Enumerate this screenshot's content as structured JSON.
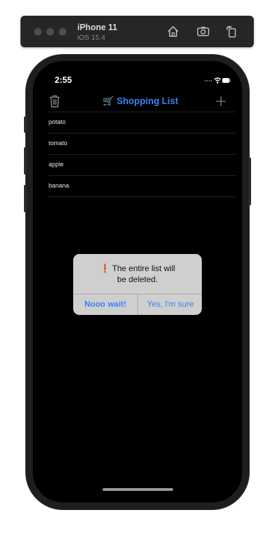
{
  "simulator": {
    "device_name": "iPhone 11",
    "os_version": "iOS 15.4",
    "icons": [
      "home-icon",
      "screenshot-icon",
      "rotate-icon"
    ]
  },
  "status_bar": {
    "time": "2:55",
    "icons": [
      "cellular-signal-icon",
      "wifi-icon",
      "battery-icon"
    ]
  },
  "nav": {
    "title_emoji": "🛒",
    "title": "Shopping List",
    "left_icon": "trash-icon",
    "right_icon": "plus-icon"
  },
  "list": {
    "items": [
      {
        "label": "potato"
      },
      {
        "label": "tomato"
      },
      {
        "label": "apple"
      },
      {
        "label": "banana"
      }
    ]
  },
  "alert": {
    "emoji": "❗",
    "message_line1": "The entire list will",
    "message_line2": "be deleted.",
    "cancel_label": "Nooo wait!",
    "confirm_label": "Yes, I'm sure"
  },
  "colors": {
    "accent": "#3a82f7",
    "alert_bg": "#cfcfcf",
    "screen_bg": "#000000"
  }
}
